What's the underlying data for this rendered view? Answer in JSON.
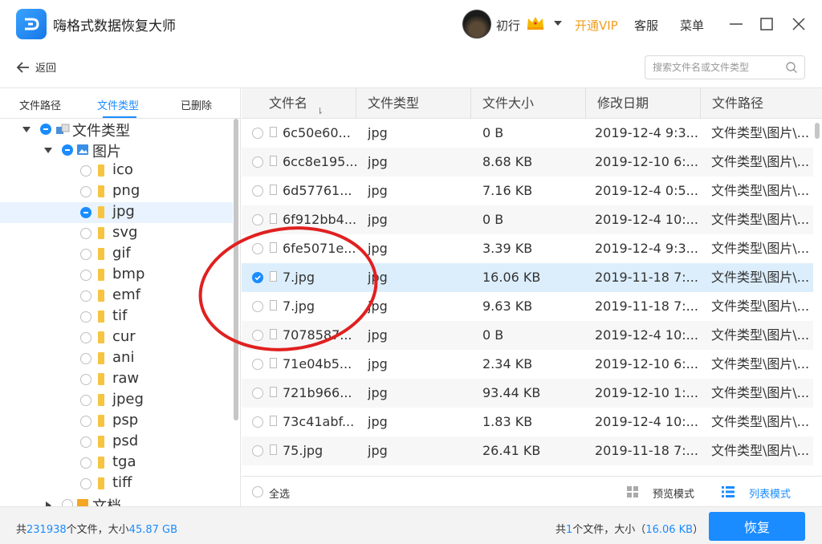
{
  "app": {
    "title": "嗨格式数据恢复大师"
  },
  "user": {
    "name": "初行"
  },
  "header": {
    "vip_label": "开通VIP",
    "service_label": "客服",
    "menu_label": "菜单"
  },
  "toolbar": {
    "back_label": "返回",
    "search_placeholder": "搜索文件名或文件类型"
  },
  "left_tabs": [
    "文件路径",
    "文件类型",
    "已删除"
  ],
  "tree": {
    "root": "文件类型",
    "group": "图片",
    "items": [
      "ico",
      "png",
      "jpg",
      "svg",
      "gif",
      "bmp",
      "emf",
      "tif",
      "cur",
      "ani",
      "raw",
      "jpeg",
      "psp",
      "psd",
      "tga",
      "tiff"
    ],
    "selected": "jpg",
    "next_group": "文档"
  },
  "table": {
    "columns": [
      "文件名",
      "文件类型",
      "文件大小",
      "修改日期",
      "文件路径"
    ],
    "rows": [
      {
        "name": "6c50e60...",
        "type": "jpg",
        "size": "0 B",
        "date": "2019-12-4 9:3...",
        "path": "文件类型\\图片\\..."
      },
      {
        "name": "6cc8e195...",
        "type": "jpg",
        "size": "8.68 KB",
        "date": "2019-12-10 6:...",
        "path": "文件类型\\图片\\..."
      },
      {
        "name": "6d57761...",
        "type": "jpg",
        "size": "7.16 KB",
        "date": "2019-12-4 0:5...",
        "path": "文件类型\\图片\\..."
      },
      {
        "name": "6f912bb4...",
        "type": "jpg",
        "size": "0 B",
        "date": "2019-12-4 10:...",
        "path": "文件类型\\图片\\..."
      },
      {
        "name": "6fe5071e...",
        "type": "jpg",
        "size": "3.39 KB",
        "date": "2019-12-4 9:3...",
        "path": "文件类型\\图片\\..."
      },
      {
        "name": "7.jpg",
        "type": "jpg",
        "size": "16.06 KB",
        "date": "2019-11-18 7:...",
        "path": "文件类型\\图片\\...",
        "checked": true
      },
      {
        "name": "7.jpg",
        "type": "jpg",
        "size": "9.63 KB",
        "date": "2019-11-18 7:...",
        "path": "文件类型\\图片\\..."
      },
      {
        "name": "7078587...",
        "type": "jpg",
        "size": "0 B",
        "date": "2019-12-4 10:...",
        "path": "文件类型\\图片\\..."
      },
      {
        "name": "71e04b5...",
        "type": "jpg",
        "size": "2.34 KB",
        "date": "2019-12-10 6:...",
        "path": "文件类型\\图片\\..."
      },
      {
        "name": "721b966...",
        "type": "jpg",
        "size": "93.44 KB",
        "date": "2019-12-10 1:...",
        "path": "文件类型\\图片\\..."
      },
      {
        "name": "73c41abf...",
        "type": "jpg",
        "size": "1.83 KB",
        "date": "2019-12-4 10:...",
        "path": "文件类型\\图片\\..."
      },
      {
        "name": "75.jpg",
        "type": "jpg",
        "size": "26.41 KB",
        "date": "2019-11-18 7:...",
        "path": "文件类型\\图片\\..."
      }
    ]
  },
  "view_bar": {
    "select_all_label": "全选",
    "preview_label": "预览模式",
    "list_label": "列表模式"
  },
  "status": {
    "total_prefix": "共",
    "total_files": "231938",
    "total_mid": "个文件，大小",
    "total_size": "45.87 GB",
    "sel_prefix": "共",
    "sel_files": "1",
    "sel_mid": "个文件，大小（",
    "sel_size": "16.06 KB",
    "sel_suffix": "）"
  },
  "recover_label": "恢复",
  "colors": {
    "accent": "#1a8cff",
    "vip": "#f0a020",
    "annotation": "#e02020"
  }
}
